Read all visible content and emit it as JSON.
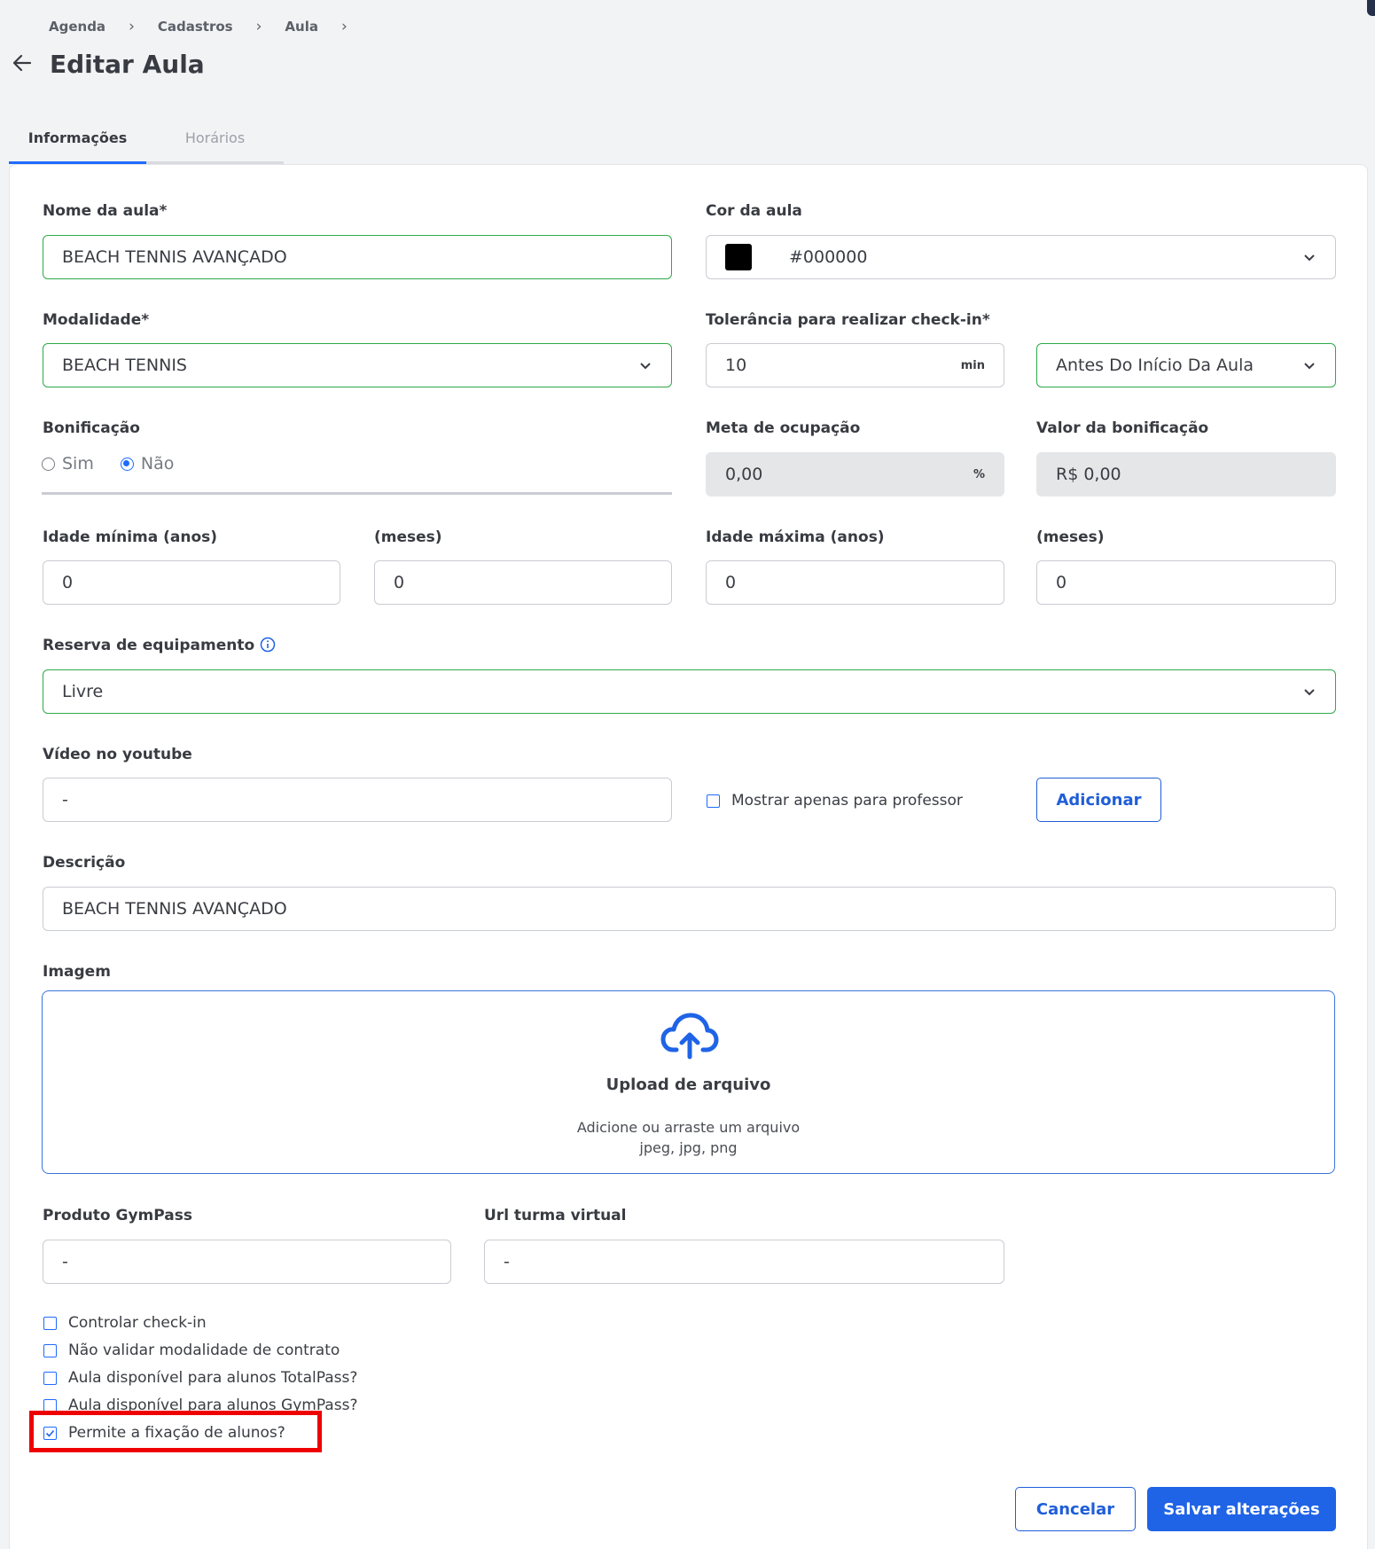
{
  "breadcrumb": [
    "Agenda",
    "Cadastros",
    "Aula"
  ],
  "page_title": "Editar Aula",
  "tabs": [
    {
      "label": "Informações",
      "active": true
    },
    {
      "label": "Horários",
      "active": false
    }
  ],
  "form": {
    "nome": {
      "label": "Nome da aula*",
      "value": "BEACH TENNIS AVANÇADO"
    },
    "cor": {
      "label": "Cor da aula",
      "value": "#000000",
      "swatch": "#000000"
    },
    "modalidade": {
      "label": "Modalidade*",
      "value": "BEACH TENNIS"
    },
    "tolerancia": {
      "label": "Tolerância para realizar check-in*",
      "value": "10",
      "unit": "min",
      "when": "Antes Do Início Da Aula"
    },
    "bonificacao": {
      "label": "Bonificação",
      "options": [
        "Sim",
        "Não"
      ],
      "selected": "Não"
    },
    "meta": {
      "label": "Meta de ocupação",
      "value": "0,00",
      "unit": "%"
    },
    "valor_bonificacao": {
      "label": "Valor da bonificação",
      "value": "R$ 0,00"
    },
    "idade_min_anos": {
      "label": "Idade mínima (anos)",
      "value": "0"
    },
    "idade_min_meses": {
      "label": "(meses)",
      "value": "0"
    },
    "idade_max_anos": {
      "label": "Idade máxima (anos)",
      "value": "0"
    },
    "idade_max_meses": {
      "label": "(meses)",
      "value": "0"
    },
    "reserva": {
      "label": "Reserva de equipamento",
      "value": "Livre"
    },
    "video": {
      "label": "Vídeo no youtube",
      "value": "-",
      "checkbox_label": "Mostrar apenas para professor",
      "button": "Adicionar"
    },
    "descricao": {
      "label": "Descrição",
      "value": "BEACH TENNIS AVANÇADO"
    },
    "imagem": {
      "label": "Imagem",
      "upload_title": "Upload de arquivo",
      "upload_hint": "Adicione ou arraste um arquivo",
      "upload_types": "jpeg, jpg, png"
    },
    "gympass_produto": {
      "label": "Produto GymPass",
      "value": "-"
    },
    "url_turma": {
      "label": "Url turma virtual",
      "value": "-"
    },
    "checkboxes": [
      {
        "label": "Controlar check-in",
        "checked": false
      },
      {
        "label": "Não validar modalidade de contrato",
        "checked": false
      },
      {
        "label": "Aula disponível para alunos TotalPass?",
        "checked": false
      },
      {
        "label": "Aula disponível para alunos GymPass?",
        "checked": false
      },
      {
        "label": "Permite a fixação de alunos?",
        "checked": true
      }
    ]
  },
  "actions": {
    "cancel": "Cancelar",
    "save": "Salvar alterações"
  },
  "colors": {
    "accent": "#1f63e6",
    "valid": "#2ea94a",
    "highlight": "#ee0000"
  }
}
